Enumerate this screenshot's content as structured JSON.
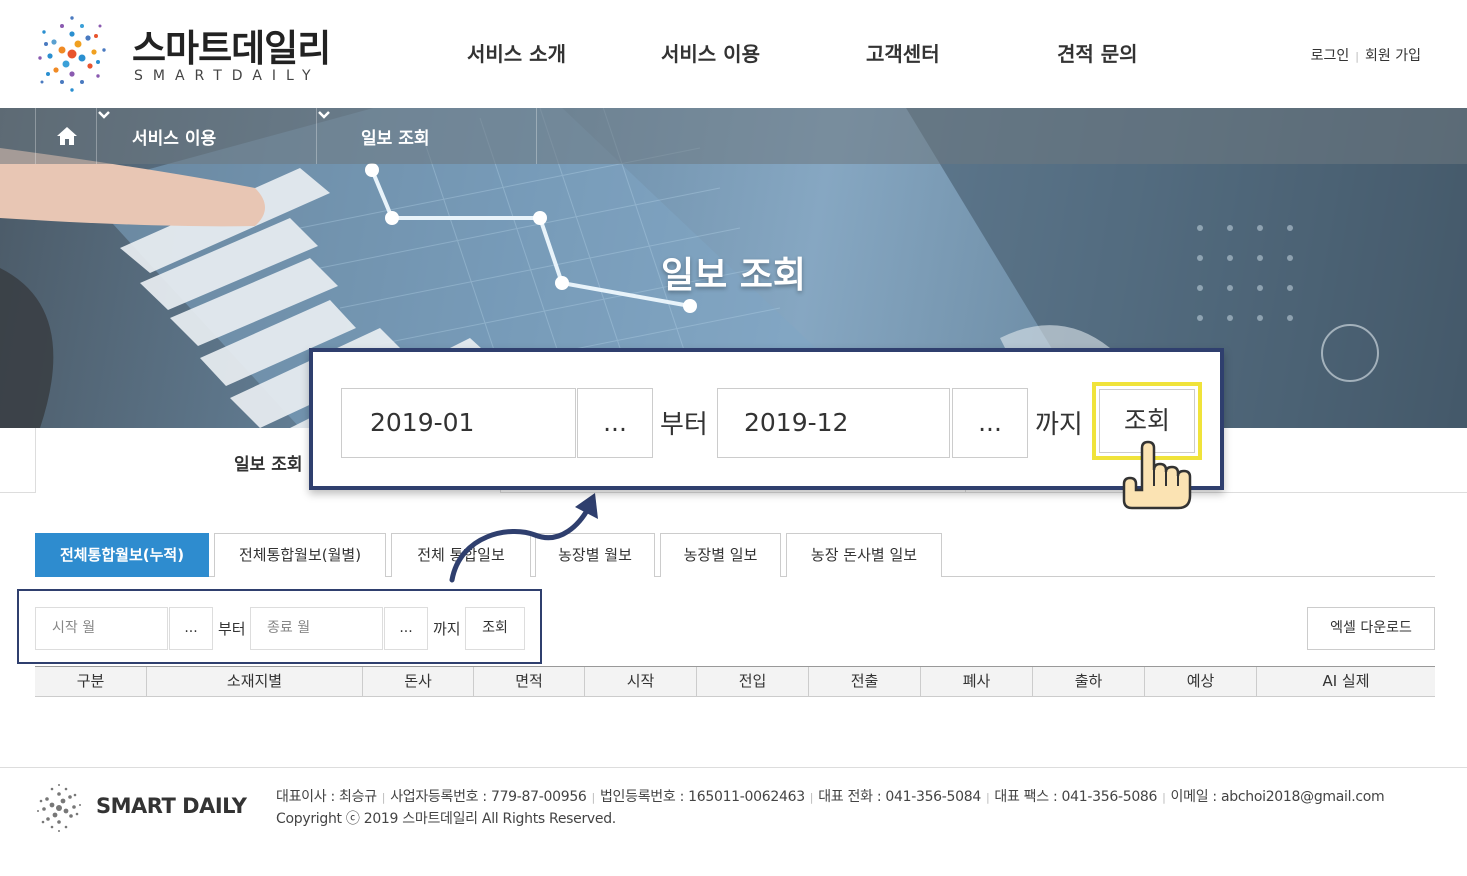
{
  "header": {
    "logo_kr": "스마트데일리",
    "logo_en": "SMARTDAILY",
    "nav": [
      "서비스 소개",
      "서비스 이용",
      "고객센터",
      "견적 문의"
    ],
    "login": "로그인",
    "signup": "회원 가입"
  },
  "breadcrumb": {
    "level1": "서비스 이용",
    "level2": "일보 조회"
  },
  "hero": {
    "title": "일보 조회"
  },
  "subtab": {
    "active": "일보 조회"
  },
  "tabs": [
    "전체통합월보(누적)",
    "전체통합월보(월별)",
    "전체 통합일보",
    "농장별 월보",
    "농장별 일보",
    "농장 돈사별 일보"
  ],
  "filter": {
    "start_placeholder": "시작 월",
    "end_placeholder": "종료 월",
    "picker": "...",
    "from": "부터",
    "to": "까지",
    "search": "조회",
    "excel": "엑셀 다운로드"
  },
  "callout": {
    "start_value": "2019-01",
    "end_value": "2019-12",
    "picker": "...",
    "from": "부터",
    "to": "까지",
    "search": "조회"
  },
  "table": {
    "headers": [
      "구분",
      "소재지별",
      "돈사",
      "면적",
      "시작",
      "전입",
      "전출",
      "폐사",
      "출하",
      "예상",
      "AI 실제"
    ]
  },
  "footer": {
    "logo": "SMART DAILY",
    "ceo": "대표이사 : 최승규",
    "biz_no": "사업자등록번호 : 779-87-00956",
    "corp_no": "법인등록번호 : 165011-0062463",
    "tel": "대표 전화 : 041-356-5084",
    "fax": "대표 팩스 : 041-356-5086",
    "email": "이메일 : abchoi2018@gmail.com",
    "copyright": "Copyright ⓒ 2019 스마트데일리 All Rights Reserved."
  },
  "colors": {
    "accent": "#2e8ccf",
    "callout_border": "#2f3f6e",
    "highlight": "#f0e33a"
  }
}
